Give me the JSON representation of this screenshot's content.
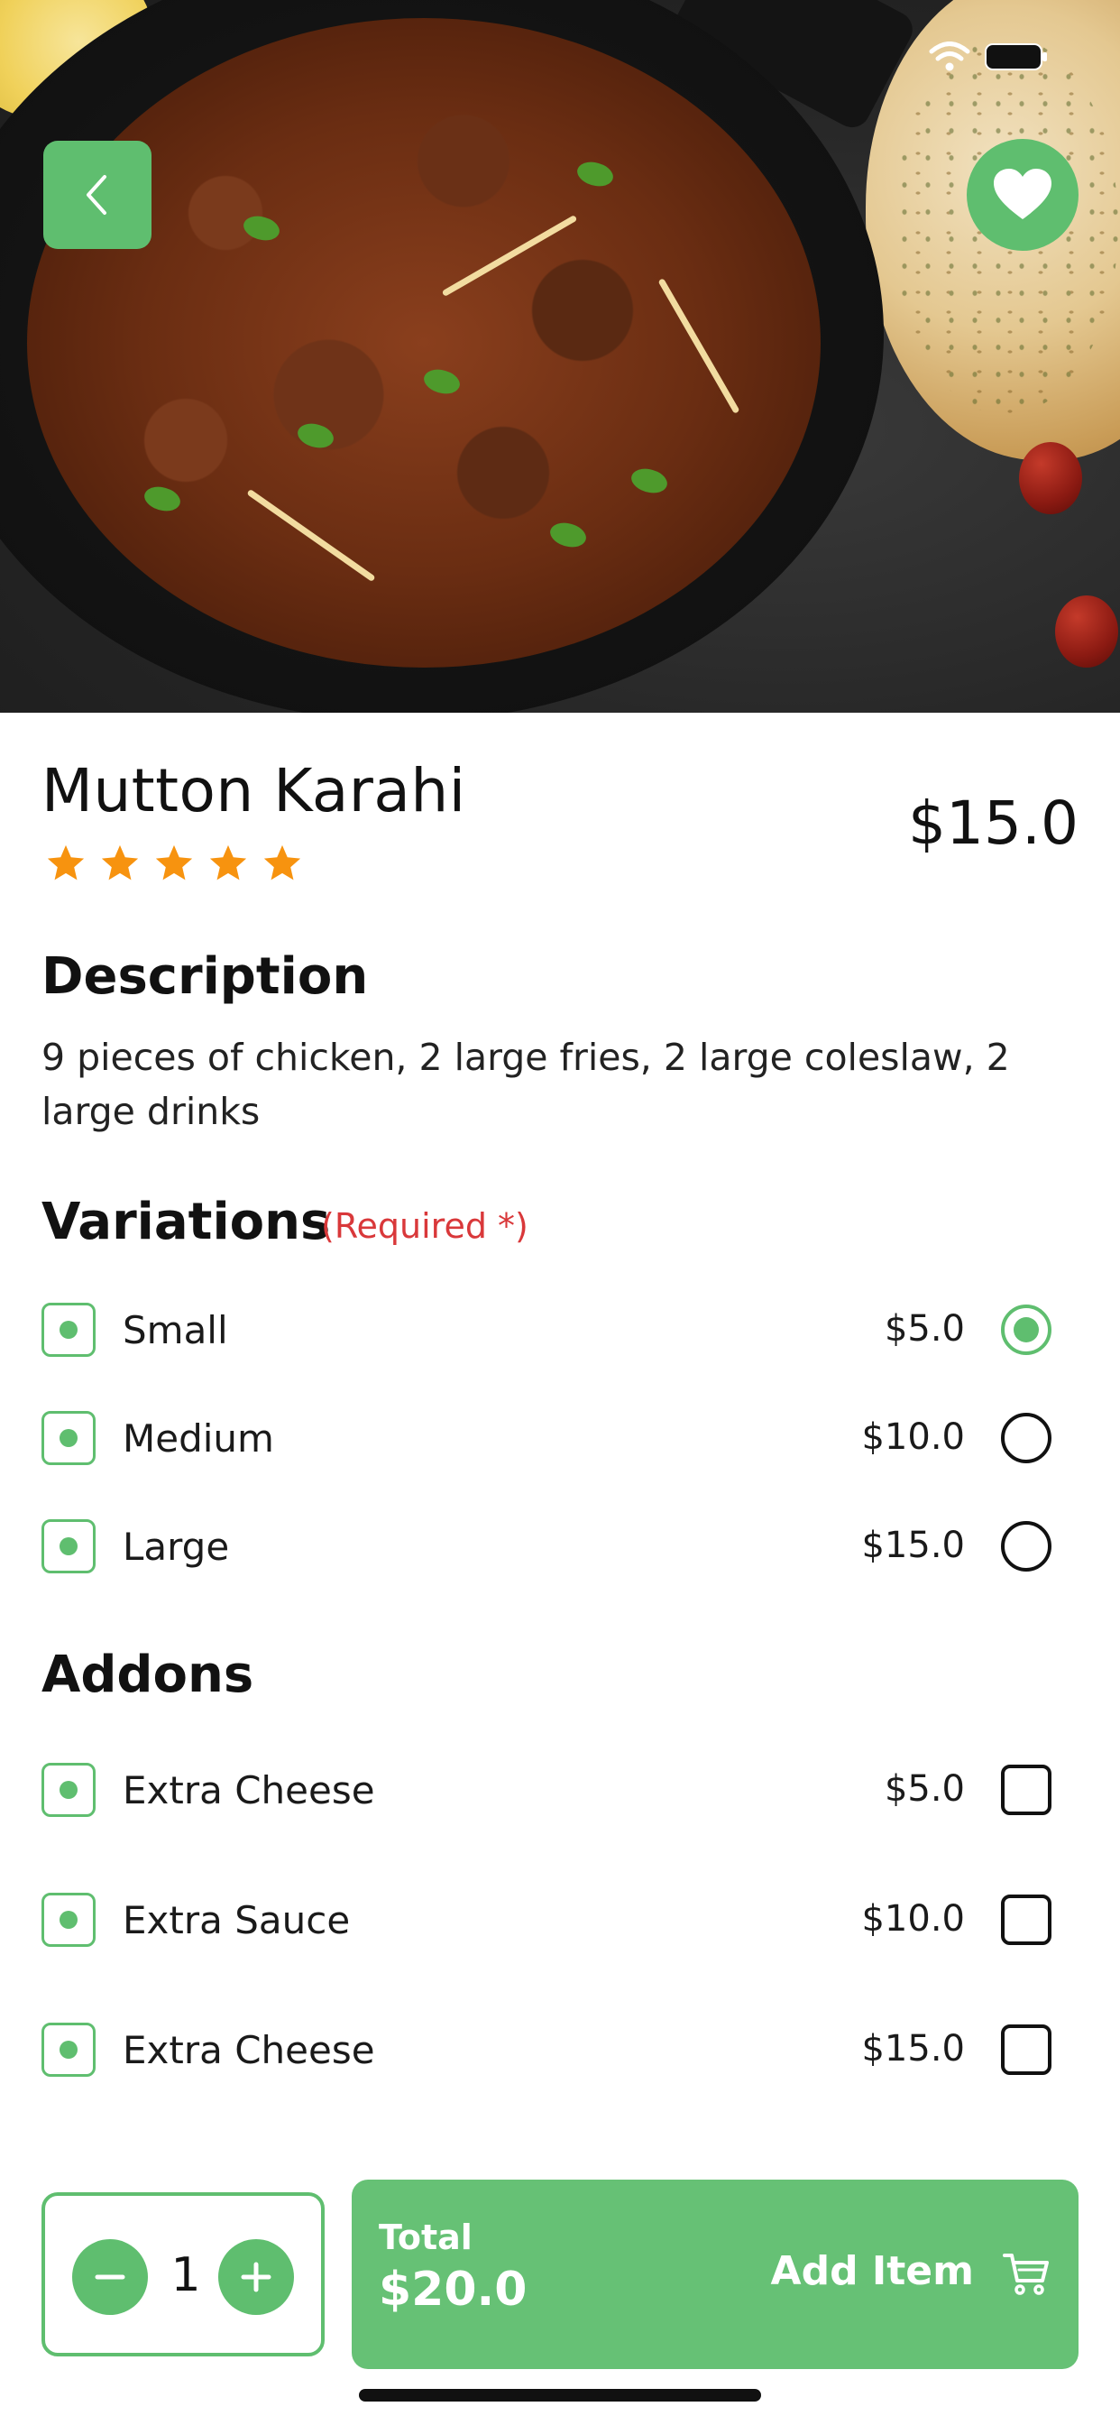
{
  "header": {
    "back_icon": "chevron-left-icon",
    "favorite_icon": "heart-icon"
  },
  "product": {
    "name": "Mutton Karahi",
    "price": "$15.0",
    "rating": 5,
    "rating_max": 5
  },
  "description": {
    "title": "Description",
    "text": "9 pieces of chicken, 2 large fries, 2 large coleslaw, 2 large drinks"
  },
  "variations": {
    "title": "Variations",
    "required_label": "(Required *)",
    "items": [
      {
        "label": "Small",
        "price": "$5.0",
        "selected": true
      },
      {
        "label": "Medium",
        "price": "$10.0",
        "selected": false
      },
      {
        "label": "Large",
        "price": "$15.0",
        "selected": false
      }
    ]
  },
  "addons": {
    "title": "Addons",
    "items": [
      {
        "label": "Extra Cheese",
        "price": "$5.0",
        "checked": false
      },
      {
        "label": "Extra Sauce",
        "price": "$10.0",
        "checked": false
      },
      {
        "label": "Extra Cheese",
        "price": "$15.0",
        "checked": false
      }
    ]
  },
  "cart": {
    "quantity": "1",
    "total_label": "Total",
    "total_value": "$20.0",
    "add_label": "Add Item",
    "cart_icon": "cart-icon"
  },
  "colors": {
    "accent": "#5fbe6f",
    "required": "#d9383a",
    "star": "#f7930f"
  }
}
